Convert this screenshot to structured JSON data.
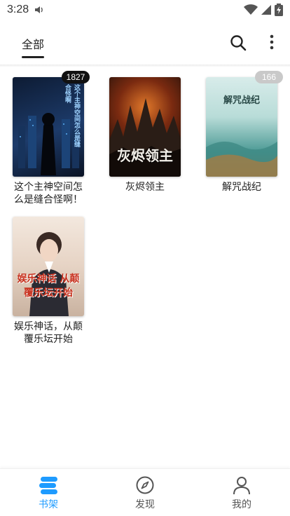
{
  "status_bar": {
    "time": "3:28"
  },
  "top_bar": {
    "tab_label": "全部"
  },
  "books": [
    {
      "title": "这个主神空间怎么是缝合怪啊！",
      "badge": "1827",
      "badge_style": "dark",
      "cover_colors": [
        "#0d1b33",
        "#1f3a66"
      ],
      "cover_text": "这个主神空间怎么是缝合怪啊"
    },
    {
      "title": "灰烬领主",
      "badge": "",
      "badge_style": "",
      "cover_colors": [
        "#1a0f0a",
        "#8a3a12"
      ],
      "cover_text": "灰烬领主"
    },
    {
      "title": "解咒战纪",
      "badge": "166",
      "badge_style": "light",
      "cover_colors": [
        "#cfe7e4",
        "#3f8f8b"
      ],
      "cover_text": "解咒战纪"
    },
    {
      "title": "娱乐神话，从颠覆乐坛开始",
      "badge": "",
      "badge_style": "",
      "cover_colors": [
        "#f2e6dc",
        "#b73a2a"
      ],
      "cover_text": "娱乐神话 从颠覆乐坛开始"
    }
  ],
  "bottom_nav": [
    {
      "label": "书架",
      "icon": "bookshelf-icon",
      "active": true
    },
    {
      "label": "发现",
      "icon": "compass-icon",
      "active": false
    },
    {
      "label": "我的",
      "icon": "person-icon",
      "active": false
    }
  ],
  "colors": {
    "accent": "#1e9bff",
    "badge_dark": "#111111",
    "badge_light": "#c9c9c9"
  }
}
